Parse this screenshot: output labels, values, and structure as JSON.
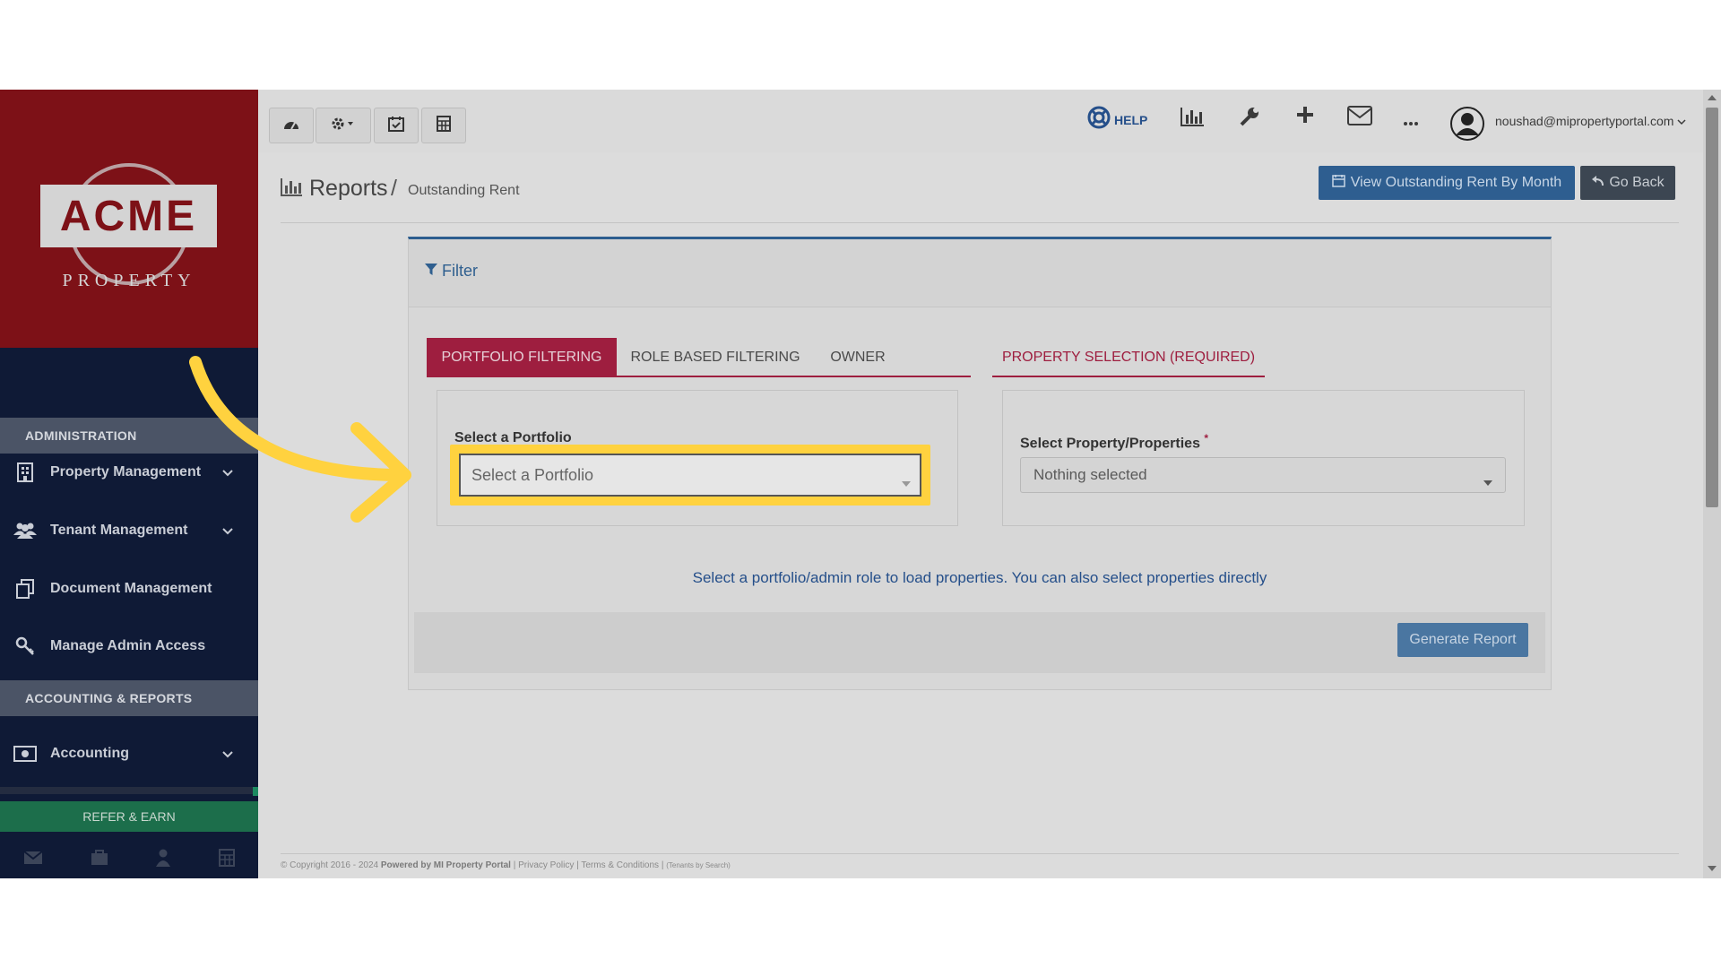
{
  "logo": {
    "main": "ACME",
    "sub": "PROPERTY"
  },
  "sidebar": {
    "sections": [
      {
        "header": "ADMINISTRATION"
      },
      {
        "header": "ACCOUNTING & REPORTS"
      }
    ],
    "items": [
      {
        "label": "Property Management",
        "icon": "building-icon",
        "has_chevron": true
      },
      {
        "label": "Tenant Management",
        "icon": "users-icon",
        "has_chevron": true
      },
      {
        "label": "Document Management",
        "icon": "documents-icon",
        "has_chevron": false
      },
      {
        "label": "Manage Admin Access",
        "icon": "key-icon",
        "has_chevron": false
      },
      {
        "label": "Accounting",
        "icon": "money-icon",
        "has_chevron": true
      }
    ],
    "refer_earn": "REFER & EARN",
    "bottom_icons": [
      "mail-icon",
      "briefcase-icon",
      "user-icon",
      "calculator-icon"
    ]
  },
  "topbar": {
    "left_buttons": [
      "dashboard-icon",
      "settings-icon",
      "calendar-icon",
      "calculator-icon"
    ],
    "help_label": "HELP",
    "right_icons": [
      "chart-icon",
      "wrench-icon",
      "plus-icon",
      "mail-icon",
      "more-icon"
    ],
    "user_email": "noushad@mipropertyportal.com"
  },
  "header": {
    "title": "Reports",
    "separator": "/",
    "breadcrumb_current": "Outstanding Rent",
    "view_by_month_label": "View Outstanding Rent By Month",
    "go_back_label": "Go Back"
  },
  "filter": {
    "title": "Filter",
    "tabs": [
      "PORTFOLIO FILTERING",
      "ROLE BASED FILTERING",
      "OWNER"
    ],
    "active_tab": "PORTFOLIO FILTERING",
    "property_tab": "PROPERTY SELECTION (REQUIRED)",
    "portfolio_label": "Select a Portfolio",
    "portfolio_placeholder": "Select a Portfolio",
    "property_label": "Select Property/Properties",
    "property_required_mark": "*",
    "property_value": "Nothing selected",
    "hint": "Select a portfolio/admin role to load properties. You can also select properties directly",
    "generate_label": "Generate Report"
  },
  "footer": {
    "copyright": "© Copyright 2016 - 2024",
    "powered": "Powered by MI Property Portal",
    "sep1": "|",
    "privacy": "Privacy Policy",
    "sep2": "|",
    "terms": "Terms & Conditions",
    "sep3": "|",
    "tenants": "(Tenants by Search)"
  },
  "colors": {
    "accent_blue": "#2c5d8f",
    "brand_red": "#9e1e3f",
    "highlight_yellow": "#ffd23f",
    "sidebar_bg": "#0f1a36",
    "logo_bg": "#7d1117"
  }
}
